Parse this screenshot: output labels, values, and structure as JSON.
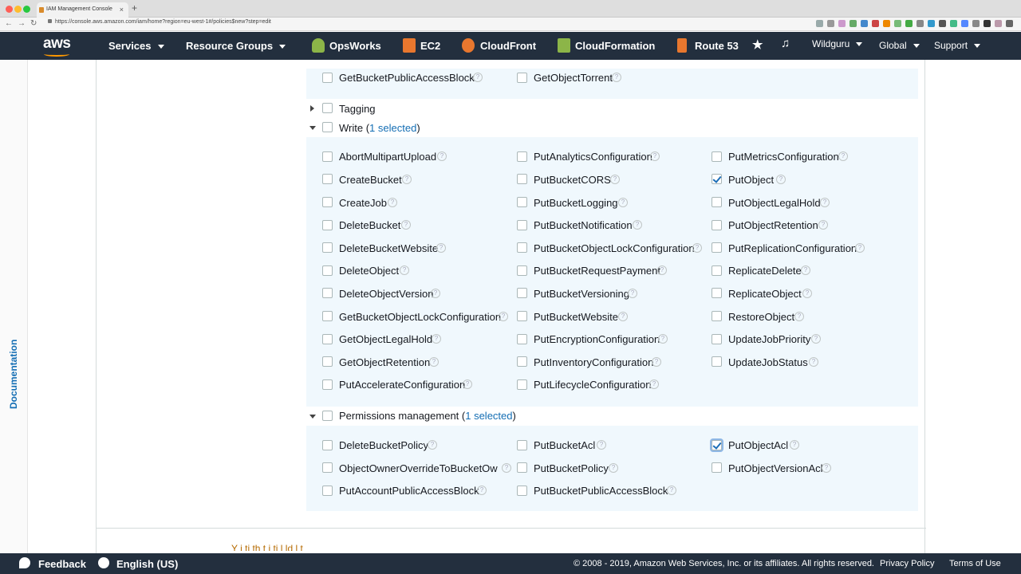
{
  "browser": {
    "tab_title": "IAM Management Console",
    "url": "https://console.aws.amazon.com/iam/home?region=eu-west-1#/policies$new?step=edit"
  },
  "nav": {
    "logo": "aws",
    "services": "Services",
    "resource_groups": "Resource Groups",
    "shortcuts": [
      "OpsWorks",
      "EC2",
      "CloudFront",
      "CloudFormation",
      "Route 53"
    ],
    "user": "Wildguru",
    "region": "Global",
    "support": "Support"
  },
  "sidebar": {
    "documentation": "Documentation"
  },
  "top_partial": {
    "items": [
      "GetBucketPublicAccessBlock",
      "GetObjectTorrent"
    ]
  },
  "tagging": {
    "label": "Tagging"
  },
  "write": {
    "label": "Write (",
    "selected": "1 selected",
    "close": ")",
    "col1": [
      "AbortMultipartUpload",
      "CreateBucket",
      "CreateJob",
      "DeleteBucket",
      "DeleteBucketWebsite",
      "DeleteObject",
      "DeleteObjectVersion",
      "GetBucketObjectLockConfiguration",
      "GetObjectLegalHold",
      "GetObjectRetention",
      "PutAccelerateConfiguration"
    ],
    "col2": [
      "PutAnalyticsConfiguration",
      "PutBucketCORS",
      "PutBucketLogging",
      "PutBucketNotification",
      "PutBucketObjectLockConfiguration",
      "PutBucketRequestPayment",
      "PutBucketVersioning",
      "PutBucketWebsite",
      "PutEncryptionConfiguration",
      "PutInventoryConfiguration",
      "PutLifecycleConfiguration"
    ],
    "col3": [
      "PutMetricsConfiguration",
      "PutObject",
      "PutObjectLegalHold",
      "PutObjectRetention",
      "PutReplicationConfiguration",
      "ReplicateDelete",
      "ReplicateObject",
      "RestoreObject",
      "UpdateJobPriority",
      "UpdateJobStatus"
    ]
  },
  "permissions": {
    "label": "Permissions management (",
    "selected": "1 selected",
    "close": ")",
    "col1": [
      "DeleteBucketPolicy",
      "ObjectOwnerOverrideToBucketOw…",
      "PutAccountPublicAccessBlock"
    ],
    "col2": [
      "PutBucketAcl",
      "PutBucketPolicy",
      "PutBucketPublicAccessBlock"
    ],
    "col3": [
      "PutObjectAcl",
      "PutObjectVersionAcl"
    ]
  },
  "cutoff_text": "Y    i         ti     th t    i  ti   l ld  l       t",
  "footer": {
    "feedback": "Feedback",
    "language": "English (US)",
    "copyright": "© 2008 - 2019, Amazon Web Services, Inc. or its affiliates. All rights reserved.",
    "privacy": "Privacy Policy",
    "terms": "Terms of Use"
  },
  "colors": {
    "nav_bg": "#232f3e",
    "accent": "#ff9900",
    "link": "#146eb4",
    "box_bg": "#f0f8fd"
  }
}
